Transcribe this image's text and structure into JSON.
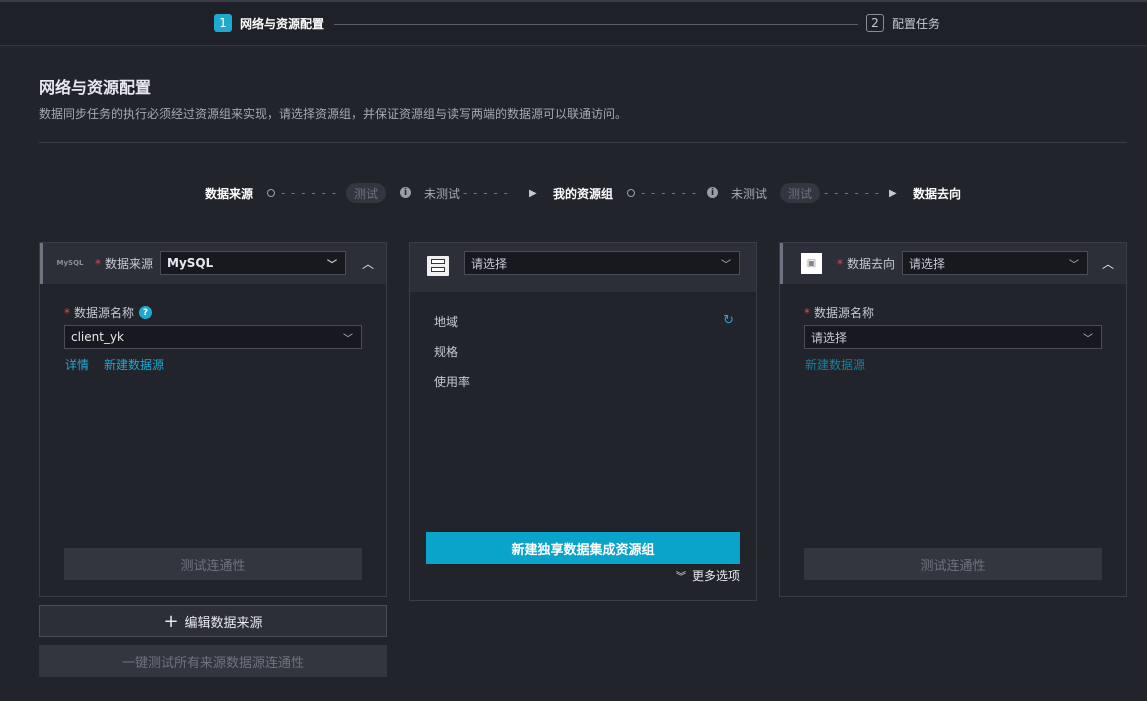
{
  "steps": [
    {
      "num": "1",
      "label": "网络与资源配置"
    },
    {
      "num": "2",
      "label": "配置任务"
    }
  ],
  "section": {
    "title": "网络与资源配置",
    "description": "数据同步任务的执行必须经过资源组来实现，请选择资源组，并保证资源组与读写两端的数据源可以联通访问。"
  },
  "flow": {
    "source": "数据来源",
    "test_pill_1": "测试",
    "untested_1": "未测试",
    "resource_group": "我的资源组",
    "untested_2": "未测试",
    "test_pill_2": "测试",
    "destination": "数据去向",
    "dashes_a": "- - - - - -",
    "dashes_b": "- - - - -",
    "dashes_c": "- - - - - -",
    "dashes_d": "- - - - - -"
  },
  "source_panel": {
    "logo_text": "MySQL",
    "label": "数据来源",
    "type_value": "MySQL",
    "ds_name_label": "数据源名称",
    "ds_name_value": "client_yk",
    "link_details": "详情",
    "link_new": "新建数据源",
    "test_button": "测试连通性"
  },
  "resource_panel": {
    "select_placeholder": "请选择",
    "region_label": "地域",
    "spec_label": "规格",
    "usage_label": "使用率",
    "create_button": "新建独享数据集成资源组",
    "more_options": "更多选项"
  },
  "dest_panel": {
    "label": "数据去向",
    "type_placeholder": "请选择",
    "ds_name_label": "数据源名称",
    "ds_name_placeholder": "请选择",
    "link_new": "新建数据源",
    "test_button": "测试连通性"
  },
  "bottom": {
    "edit_source_button": "编辑数据来源",
    "test_all_button": "一键测试所有来源数据源连通性"
  }
}
